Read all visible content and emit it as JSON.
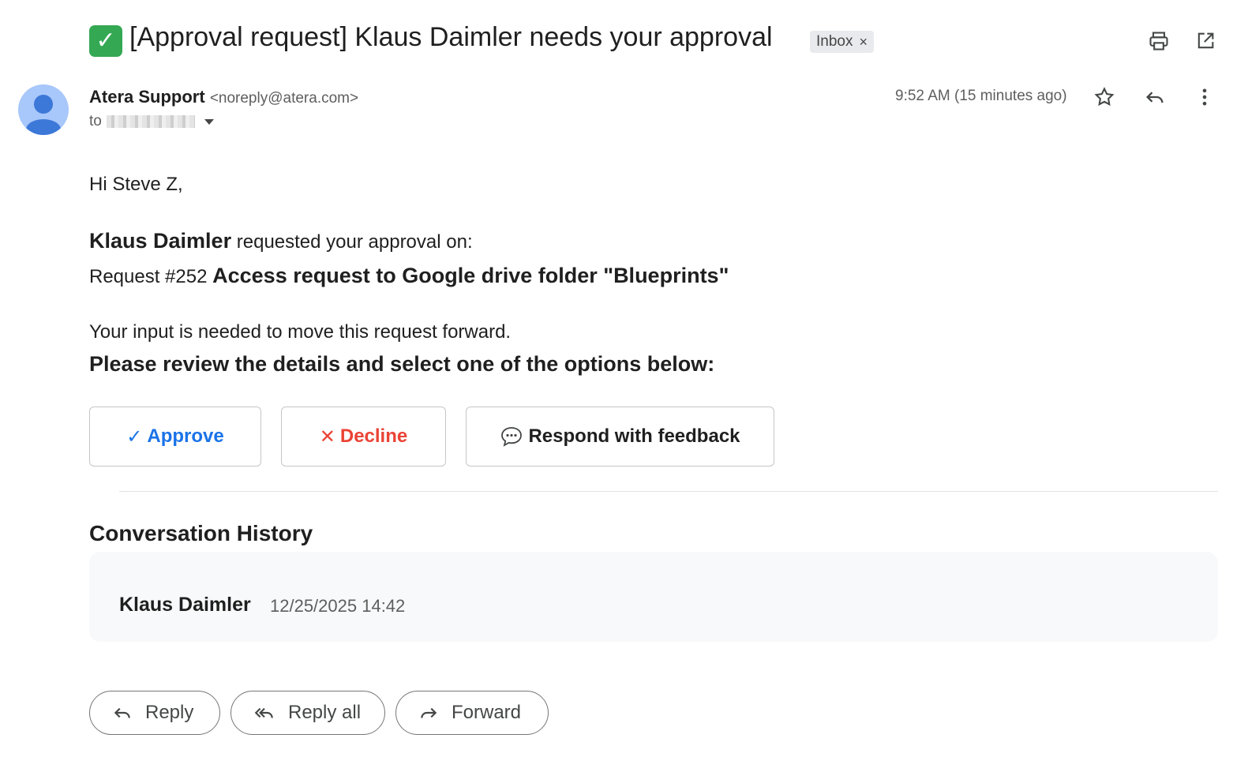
{
  "email": {
    "subject_icon": "✓",
    "subject": "[Approval request] Klaus Daimler needs your approval",
    "label": "Inbox",
    "label_close": "×",
    "icons": {
      "print": "print-icon",
      "popout": "open-in-new-window-icon",
      "star": "star-icon",
      "reply": "reply-icon",
      "more": "more-vertical-icon"
    },
    "sender_name": "Atera Support",
    "sender_email": "<noreply@atera.com>",
    "to_prefix": "to",
    "time": "9:52 AM (15 minutes ago)"
  },
  "body": {
    "greeting": "Hi Steve Z,",
    "requester": "Klaus Daimler",
    "requested_text": "requested your approval on:",
    "request_prefix": "Request #252",
    "request_title": "Access request to Google drive folder \"Blueprints\"",
    "input_needed": "Your input is needed to move this request forward.",
    "review_prompt": "Please review the details and select one of the options below:"
  },
  "actions": {
    "approve_icon": "✓",
    "approve": "Approve",
    "decline_icon": "✕",
    "decline": "Decline",
    "feedback": "Respond with feedback"
  },
  "conversation": {
    "title": "Conversation History",
    "entries": [
      {
        "name": "Klaus Daimler",
        "date": "12/25/2025 14:42"
      }
    ]
  },
  "reply_bar": {
    "reply": "Reply",
    "reply_all": "Reply all",
    "forward": "Forward"
  },
  "colors": {
    "approve": "#1a73e8",
    "decline": "#ea4335",
    "check_green": "#34a853",
    "avatar": "#a8c7fa"
  }
}
